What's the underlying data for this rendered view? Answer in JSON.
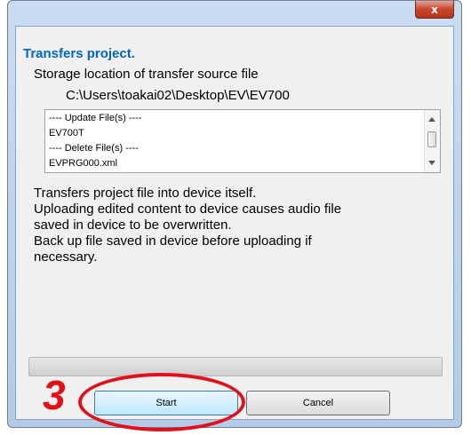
{
  "dialog": {
    "close_icon": "close-icon",
    "close_glyph": "x",
    "heading": "Transfers project.",
    "storage_label": "Storage location of transfer source file",
    "storage_path": "C:\\Users\\toakai02\\Desktop\\EV\\EV700",
    "file_list": [
      "---- Update File(s) ----",
      "EV700T",
      "---- Delete File(s) ----",
      "EVPRG000.xml"
    ],
    "description": [
      "Transfers project file into device itself.",
      "Uploading edited content to device causes audio file",
      "saved in device to be overwritten.",
      "Back up file saved in device before uploading if",
      "necessary."
    ],
    "progress_percent": 0,
    "start_label": "Start",
    "cancel_label": "Cancel"
  },
  "annotation": {
    "step_number": "3",
    "color": "#e2101a"
  }
}
